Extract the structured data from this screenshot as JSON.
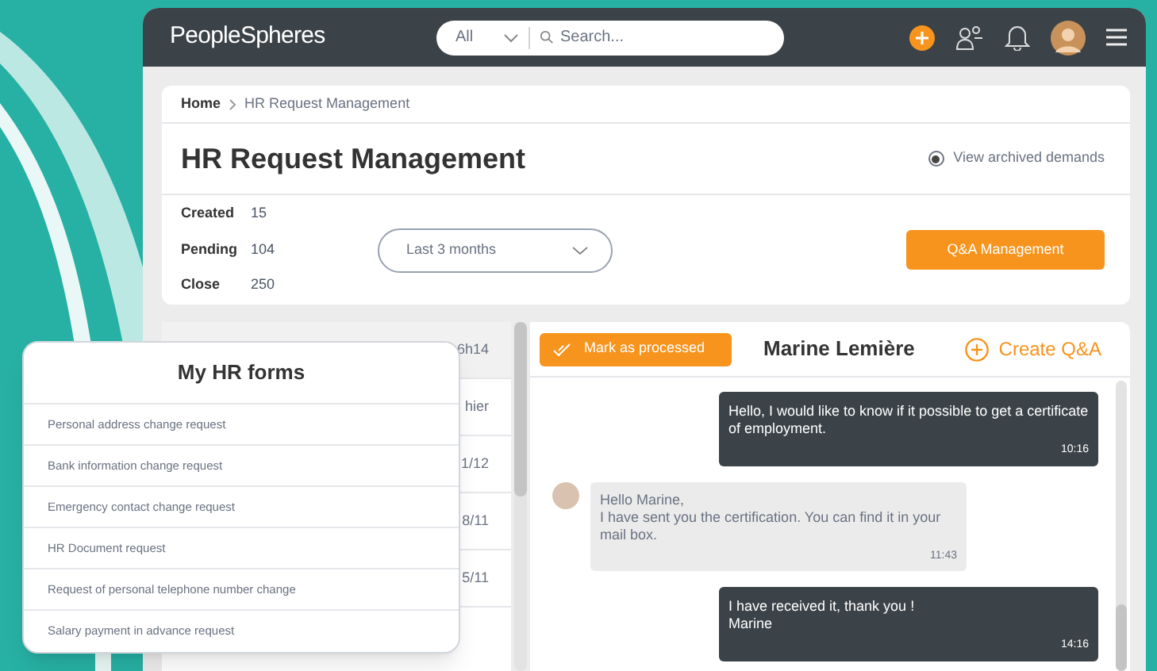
{
  "header": {
    "logo": "PeopleSpheres",
    "search": {
      "scope": "All",
      "placeholder": "Search..."
    }
  },
  "breadcrumb": [
    "Home",
    "HR Request Management"
  ],
  "page_title": "HR Request Management",
  "archived_toggle": {
    "label": "View archived demands",
    "selected": true
  },
  "stats": [
    {
      "label": "Created",
      "value": "15"
    },
    {
      "label": "Pending",
      "value": "104"
    },
    {
      "label": "Close",
      "value": "250"
    }
  ],
  "period_filter": "Last 3 months",
  "qa_button": "Q&A Management",
  "requests": [
    {
      "time": "6h14",
      "selected": true
    },
    {
      "time": "hier",
      "selected": false
    },
    {
      "time": "1/12",
      "selected": false
    },
    {
      "time": "8/11",
      "selected": false
    },
    {
      "time": "5/11",
      "selected": false
    }
  ],
  "chat": {
    "mark_button": "Mark as processed",
    "contact": "Marine Lemière",
    "create_button": "Create Q&A",
    "messages": [
      {
        "kind": "sent",
        "text": "Hello, I would like to know if it possible to get a certificate of employment.",
        "time": "10:16"
      },
      {
        "kind": "received",
        "text": "Hello Marine,\nI have sent you the certification. You can find it in your mail box.",
        "time": "11:43"
      },
      {
        "kind": "sent",
        "text": "I have received it, thank you !\nMarine",
        "time": "14:16"
      }
    ]
  },
  "forms_popup": {
    "title": "My HR forms",
    "items": [
      "Personal address change request",
      "Bank information change request",
      "Emergency contact change request",
      "HR Document request",
      "Request of personal telephone number change",
      "Salary payment in advance request"
    ]
  }
}
